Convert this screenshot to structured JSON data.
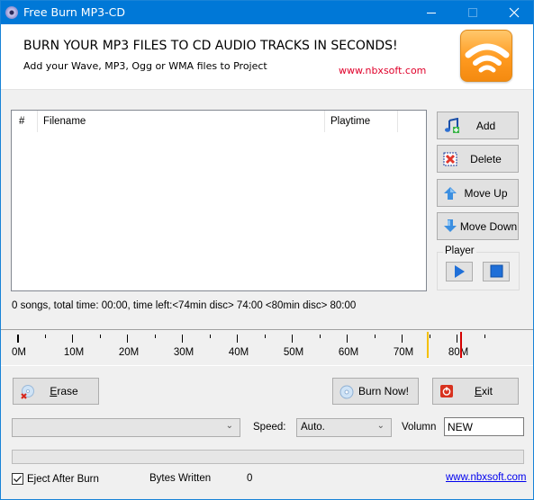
{
  "window": {
    "title": "Free Burn MP3-CD",
    "controls": {
      "minimize": "minimize",
      "maximize": "maximize",
      "close": "close"
    }
  },
  "header": {
    "headline": "BURN YOUR MP3 FILES TO CD AUDIO TRACKS IN SECONDS!",
    "subline": "Add your Wave, MP3, Ogg or WMA files to Project",
    "website": "www.nbxsoft.com",
    "logo_icon": "wifi-signal-icon"
  },
  "filelist": {
    "columns": [
      "#",
      "Filename",
      "Playtime"
    ],
    "rows": []
  },
  "side_buttons": {
    "add": {
      "label": "Add",
      "icon": "music-note-add-icon"
    },
    "delete": {
      "label": "Delete",
      "icon": "delete-x-icon"
    },
    "move_up": {
      "label": "Move Up",
      "icon": "arrow-up-icon"
    },
    "move_down": {
      "label": "Move Down",
      "icon": "arrow-down-icon"
    }
  },
  "player": {
    "label": "Player",
    "play_icon": "play-icon",
    "stop_icon": "stop-icon"
  },
  "status": {
    "text": "0 songs, total time: 00:00, time left:<74min disc> 74:00 <80min disc> 80:00"
  },
  "ruler": {
    "unit": "M",
    "labels": [
      "0M",
      "10M",
      "20M",
      "30M",
      "40M",
      "50M",
      "60M",
      "70M",
      "80M"
    ],
    "major_values": [
      0,
      10,
      20,
      30,
      40,
      50,
      60,
      70,
      80
    ],
    "minor_values": [
      5,
      15,
      25,
      35,
      45,
      55,
      65,
      75,
      85
    ],
    "max_value": 95,
    "current_value": 0,
    "markers": [
      {
        "name": "74min-disc-limit",
        "value": 74,
        "color": "#f5c000"
      },
      {
        "name": "80min-disc-limit",
        "value": 80,
        "color": "#d40000"
      }
    ]
  },
  "actions": {
    "erase": {
      "label_underlined": "E",
      "label_rest": "rase",
      "icon": "erase-disc-icon"
    },
    "burn": {
      "label": "Burn Now!",
      "icon": "cd-disc-icon"
    },
    "exit": {
      "label_underlined": "E",
      "label_rest": "xit",
      "icon": "power-icon"
    }
  },
  "settings": {
    "drive_value": "",
    "speed_label": "Speed:",
    "speed_value": "Auto.",
    "volume_label": "Volumn",
    "volume_value": "NEW"
  },
  "progress": {
    "percent": 0
  },
  "footer": {
    "eject_label_underlined": "j",
    "eject_label": "Eject After Burn",
    "eject_checked": true,
    "bytes_label": "Bytes Written",
    "bytes_value": "0",
    "website": "www.nbxsoft.com"
  }
}
